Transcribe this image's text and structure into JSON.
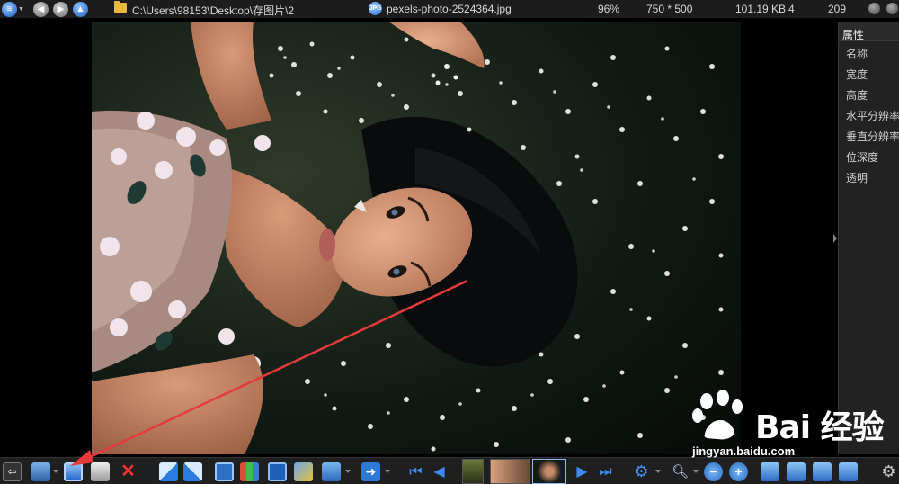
{
  "topbar": {
    "path": "C:\\Users\\98153\\Desktop\\存图片\\2",
    "filename": "pexels-photo-2524364.jpg",
    "zoom": "96%",
    "dimensions": "750 * 500",
    "file_size": "101.19 KB",
    "index": "4",
    "total": "209",
    "icons": [
      "menu-icon",
      "back-icon",
      "forward-icon",
      "up-icon",
      "folder-icon",
      "file-type-icon"
    ]
  },
  "panel": {
    "header": "属性",
    "rows": [
      "名称",
      "宽度",
      "高度",
      "水平分辨率",
      "垂直分辨率",
      "位深度",
      "透明"
    ]
  },
  "photo": {
    "description_icon": "photo-image"
  },
  "toolbar": {
    "icons": [
      "exit-fullscreen-icon",
      "open-icon",
      "save-icon",
      "print-icon",
      "delete-icon",
      "rotate-left-icon",
      "rotate-right-icon",
      "crop-icon",
      "histogram-icon",
      "resize-icon",
      "edit-icon",
      "paint-icon",
      "next-action-icon",
      "first-image-icon",
      "prev-image-icon",
      "next-image-icon",
      "last-image-icon",
      "settings-icon",
      "zoom-icon",
      "zoom-out-icon",
      "zoom-in-icon",
      "fit-icon",
      "actual-size-icon",
      "fit-width-icon",
      "fit-height-icon",
      "options-icon"
    ]
  },
  "watermark": {
    "brand": "Bai 经验",
    "url": "jingyan.baidu.com"
  },
  "colors": {
    "background": "#000000",
    "toolbar_bg": "#1f1f1f",
    "panel_bg": "#222222",
    "annotation": "#e63b3b",
    "accent_blue": "#2a6bd1"
  }
}
